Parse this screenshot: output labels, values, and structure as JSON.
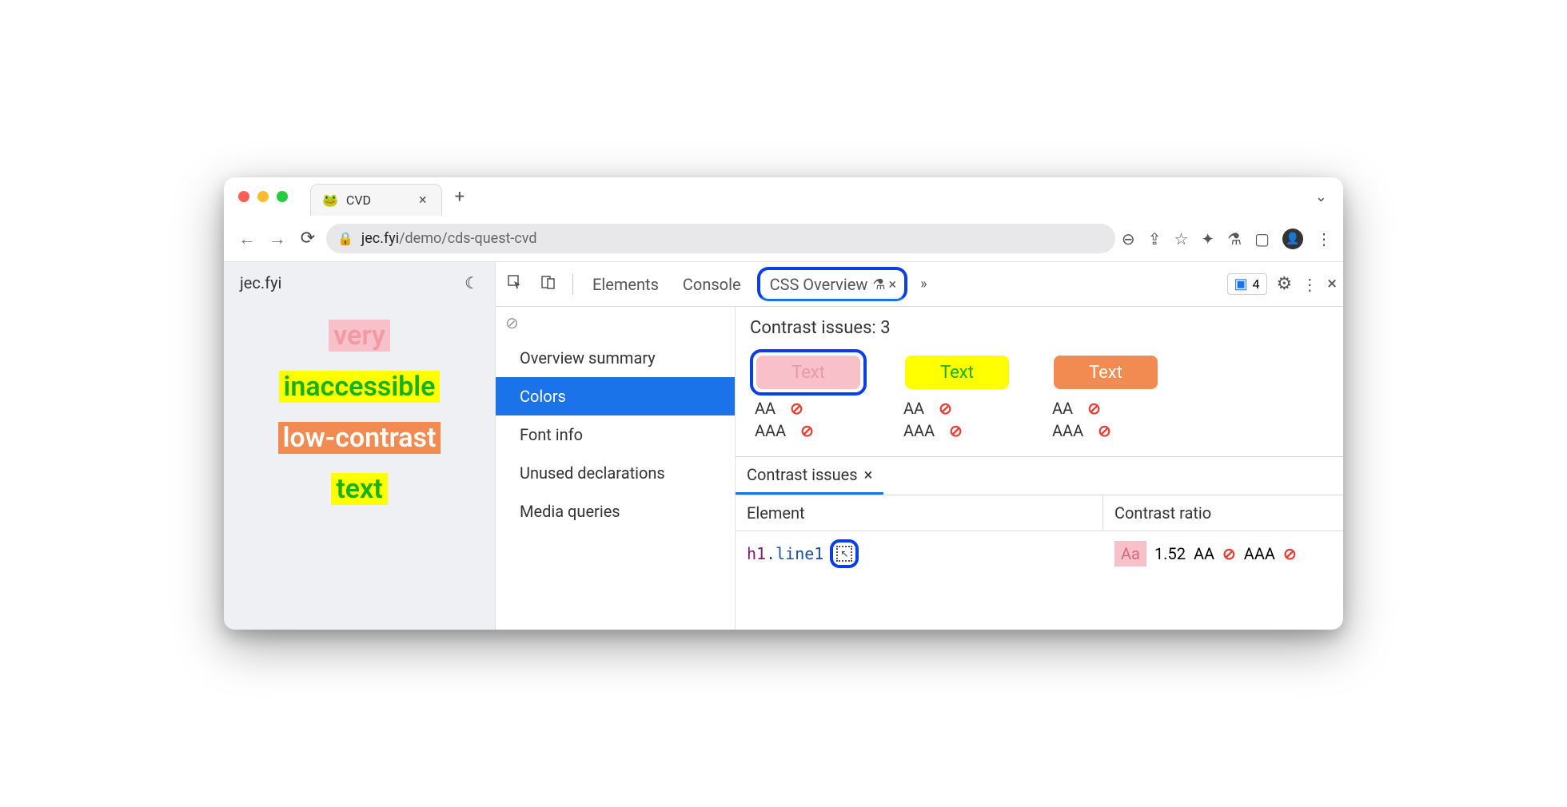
{
  "window": {
    "tab_title": "CVD",
    "favicon": "🐸",
    "url_domain": "jec.fyi",
    "url_path": "/demo/cds-quest-cvd"
  },
  "page": {
    "site_label": "jec.fyi",
    "words": [
      "very",
      "inaccessible",
      "low-contrast",
      "text"
    ]
  },
  "devtools": {
    "tabs": {
      "elements": "Elements",
      "console": "Console",
      "css_overview": "CSS Overview"
    },
    "issues_count": "4",
    "sidebar": {
      "overview": "Overview summary",
      "colors": "Colors",
      "font": "Font info",
      "unused": "Unused declarations",
      "media": "Media queries"
    },
    "contrast_heading": "Contrast issues: 3",
    "swatch_label": "Text",
    "aa_label": "AA",
    "aaa_label": "AAA",
    "contrast_tab": "Contrast issues",
    "table": {
      "element_header": "Element",
      "ratio_header": "Contrast ratio",
      "row": {
        "tag": "h1",
        "cls": ".line1",
        "aa_sample": "Aa",
        "ratio": "1.52",
        "aa": "AA",
        "aaa": "AAA"
      }
    }
  }
}
